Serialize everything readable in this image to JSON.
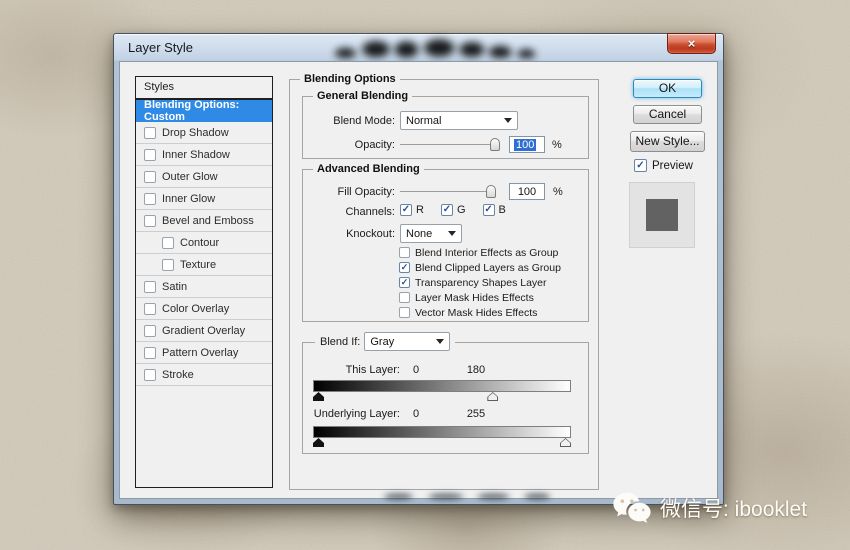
{
  "window": {
    "title": "Layer Style",
    "close_glyph": "×"
  },
  "sidebar": {
    "header": "Styles",
    "items": [
      {
        "label": "Blending Options: Custom",
        "selected": true,
        "checkbox": false,
        "indent": false
      },
      {
        "label": "Drop Shadow",
        "selected": false,
        "checkbox": true,
        "checked": false,
        "indent": false
      },
      {
        "label": "Inner Shadow",
        "selected": false,
        "checkbox": true,
        "checked": false,
        "indent": false
      },
      {
        "label": "Outer Glow",
        "selected": false,
        "checkbox": true,
        "checked": false,
        "indent": false
      },
      {
        "label": "Inner Glow",
        "selected": false,
        "checkbox": true,
        "checked": false,
        "indent": false
      },
      {
        "label": "Bevel and Emboss",
        "selected": false,
        "checkbox": true,
        "checked": false,
        "indent": false
      },
      {
        "label": "Contour",
        "selected": false,
        "checkbox": true,
        "checked": false,
        "indent": true
      },
      {
        "label": "Texture",
        "selected": false,
        "checkbox": true,
        "checked": false,
        "indent": true
      },
      {
        "label": "Satin",
        "selected": false,
        "checkbox": true,
        "checked": false,
        "indent": false
      },
      {
        "label": "Color Overlay",
        "selected": false,
        "checkbox": true,
        "checked": false,
        "indent": false
      },
      {
        "label": "Gradient Overlay",
        "selected": false,
        "checkbox": true,
        "checked": false,
        "indent": false
      },
      {
        "label": "Pattern Overlay",
        "selected": false,
        "checkbox": true,
        "checked": false,
        "indent": false
      },
      {
        "label": "Stroke",
        "selected": false,
        "checkbox": true,
        "checked": false,
        "indent": false
      }
    ]
  },
  "panel": {
    "title": "Blending Options",
    "general": {
      "title": "General Blending",
      "blend_mode_label": "Blend Mode:",
      "blend_mode_value": "Normal",
      "opacity_label": "Opacity:",
      "opacity_value": "100",
      "opacity_unit": "%",
      "opacity_selected": true
    },
    "advanced": {
      "title": "Advanced Blending",
      "fill_opacity_label": "Fill Opacity:",
      "fill_opacity_value": "100",
      "fill_opacity_unit": "%",
      "channels_label": "Channels:",
      "channels": [
        {
          "label": "R",
          "checked": true
        },
        {
          "label": "G",
          "checked": true
        },
        {
          "label": "B",
          "checked": true
        }
      ],
      "knockout_label": "Knockout:",
      "knockout_value": "None",
      "options": [
        {
          "label": "Blend Interior Effects as Group",
          "checked": false
        },
        {
          "label": "Blend Clipped Layers as Group",
          "checked": true
        },
        {
          "label": "Transparency Shapes Layer",
          "checked": true
        },
        {
          "label": "Layer Mask Hides Effects",
          "checked": false
        },
        {
          "label": "Vector Mask Hides Effects",
          "checked": false
        }
      ]
    },
    "blend_if": {
      "label": "Blend If:",
      "value": "Gray",
      "sliders": [
        {
          "label": "This Layer:",
          "low_text": "0",
          "high_text": "180",
          "low": 0,
          "high": 180,
          "max": 255
        },
        {
          "label": "Underlying Layer:",
          "low_text": "0",
          "high_text": "255",
          "low": 0,
          "high": 255,
          "max": 255
        }
      ]
    }
  },
  "actions": {
    "ok_label": "OK",
    "cancel_label": "Cancel",
    "new_style_label": "New Style...",
    "preview_label": "Preview",
    "preview_checked": true
  },
  "watermark": {
    "text": "微信号: ibooklet"
  },
  "icons": {
    "check_glyph": "✓",
    "wechat_icon": "wechat-bubbles",
    "close_icon": "close-x"
  },
  "colors": {
    "selection_blue": "#2e8ae5",
    "value_highlight": "#2f6fd3",
    "close_red": "#c94f31",
    "titlebar": "#c2d2e4",
    "dialog_bg": "#f0f0f0",
    "ok_glow": "#50afe6"
  }
}
